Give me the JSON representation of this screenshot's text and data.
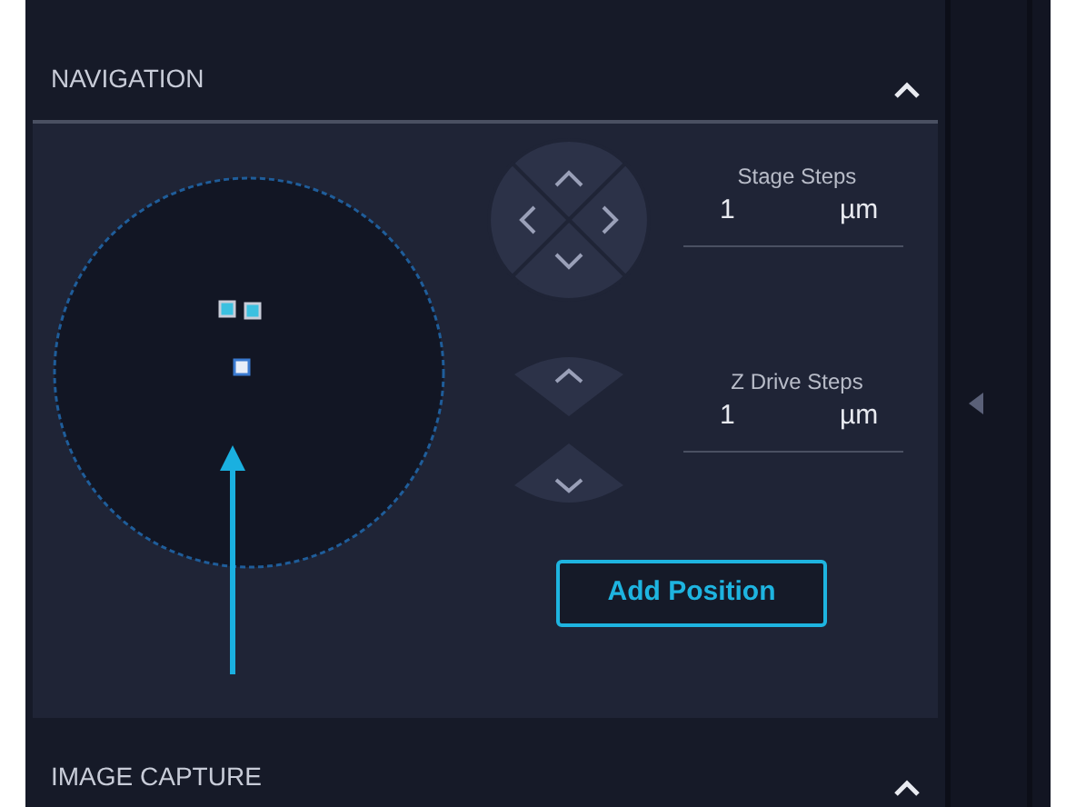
{
  "sections": [
    {
      "title": "NAVIGATION",
      "expanded": true
    },
    {
      "title": "IMAGE CAPTURE",
      "expanded": true
    }
  ],
  "stage_steps": {
    "label": "Stage Steps",
    "value": "1",
    "unit": "µm"
  },
  "z_drive_steps": {
    "label": "Z Drive Steps",
    "value": "1",
    "unit": "µm"
  },
  "add_button": "Add Position"
}
